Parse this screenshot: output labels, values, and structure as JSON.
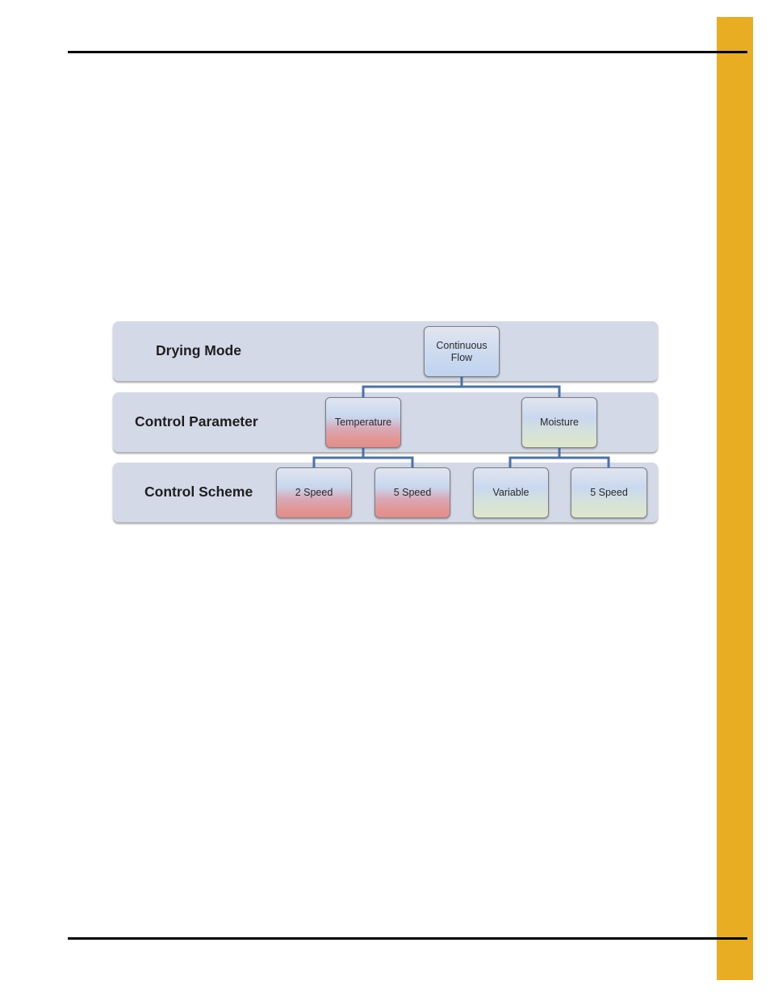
{
  "page": {
    "accent_color": "#e9ad24",
    "rule_color": "#000000"
  },
  "diagram": {
    "connector_color": "#4a72a8",
    "band_color": "#d3d9e7",
    "levels": [
      {
        "label": "Drying Mode"
      },
      {
        "label": "Control Parameter"
      },
      {
        "label": "Control Scheme"
      }
    ],
    "nodes": {
      "root": {
        "label_line1": "Continuous",
        "label_line2": "Flow",
        "level": "Drying Mode"
      },
      "temperature": {
        "label": "Temperature",
        "parent": "Continuous Flow",
        "color": "#e39592"
      },
      "moisture": {
        "label": "Moisture",
        "parent": "Continuous Flow",
        "color": "#dfe7c9"
      },
      "temp_2speed": {
        "label": "2 Speed",
        "parent": "Temperature"
      },
      "temp_5speed": {
        "label": "5 Speed",
        "parent": "Temperature"
      },
      "moist_variable": {
        "label": "Variable",
        "parent": "Moisture"
      },
      "moist_5speed": {
        "label": "5 Speed",
        "parent": "Moisture"
      }
    }
  }
}
